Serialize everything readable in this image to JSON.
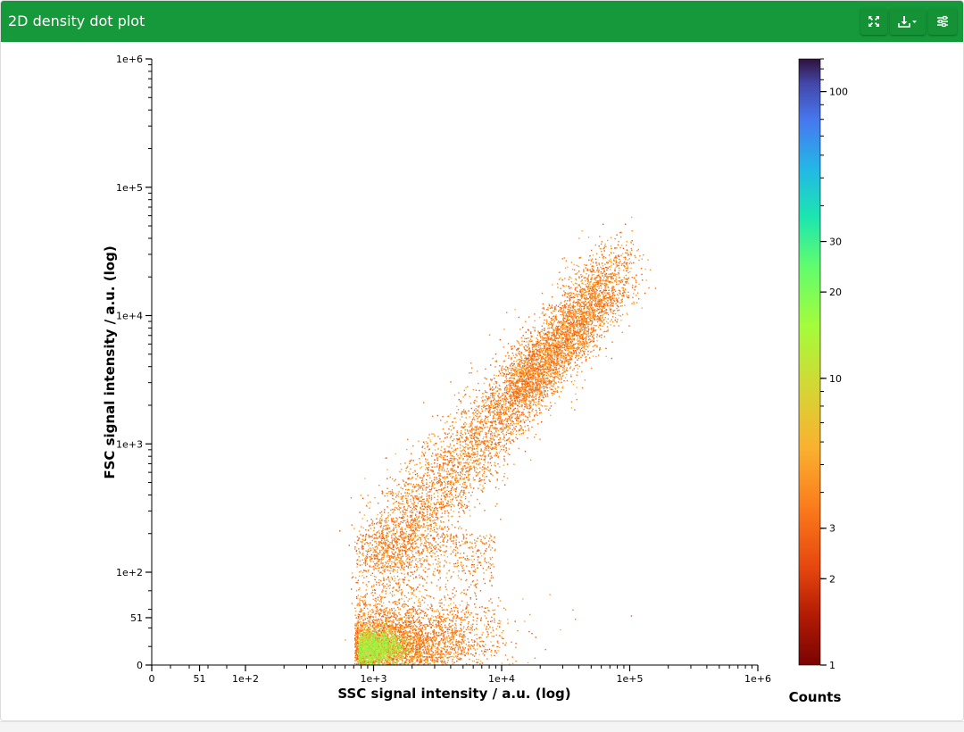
{
  "header": {
    "title": "2D density dot plot",
    "buttons": [
      {
        "name": "fullscreen-button",
        "icon": "expand-arrows-icon"
      },
      {
        "name": "download-button",
        "icon": "download-icon"
      },
      {
        "name": "settings-button",
        "icon": "sliders-icon"
      }
    ]
  },
  "chart_data": {
    "type": "scatter",
    "subtype": "2d-density-dot-plot",
    "xlabel": "SSC signal intensity / a.u. (log)",
    "ylabel": "FSC signal intensity / a.u. (log)",
    "x_scale": "logicle",
    "y_scale": "logicle",
    "x_ticks": [
      {
        "value": 0,
        "label": "0"
      },
      {
        "value": 51,
        "label": "51"
      },
      {
        "value": 100,
        "label": "1e+2"
      },
      {
        "value": 1000,
        "label": "1e+3"
      },
      {
        "value": 10000,
        "label": "1e+4"
      },
      {
        "value": 100000,
        "label": "1e+5"
      },
      {
        "value": 1000000,
        "label": "1e+6"
      }
    ],
    "y_ticks": [
      {
        "value": 0,
        "label": "0"
      },
      {
        "value": 51,
        "label": "51"
      },
      {
        "value": 100,
        "label": "1e+2"
      },
      {
        "value": 1000,
        "label": "1e+3"
      },
      {
        "value": 10000,
        "label": "1e+4"
      },
      {
        "value": 100000,
        "label": "1e+5"
      },
      {
        "value": 1000000,
        "label": "1e+6"
      }
    ],
    "xlim": [
      0,
      1000000
    ],
    "ylim": [
      0,
      1000000
    ],
    "colorbar": {
      "label": "Counts",
      "scale": "log",
      "range": [
        1,
        130
      ],
      "ticks": [
        1,
        2,
        3,
        10,
        20,
        30,
        100
      ],
      "colormap": "turbo-reversed"
    },
    "clusters": [
      {
        "name": "dense low cluster",
        "x_center": 800,
        "y_center": 20,
        "count_level": 12
      },
      {
        "name": "diagonal population",
        "x_range": [
          1000,
          90000
        ],
        "y_range": [
          100,
          25000
        ],
        "count_level": 3
      }
    ]
  }
}
